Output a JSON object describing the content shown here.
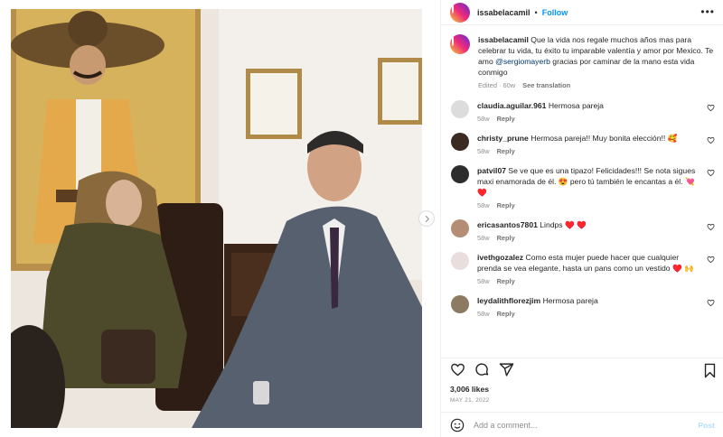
{
  "post": {
    "author": "issabelacamil",
    "follow_label": "Follow",
    "separator": "•",
    "more_label": "•••",
    "caption_text": "Que la vida nos regale muchos años mas para celebrar tu vida, tu éxito tu imparable valentía y amor por Mexico. Te amo",
    "caption_mention": "@sergiomayerb",
    "caption_tail": "gracias por caminar de la mano esta vida conmigo",
    "caption_edited": "Edited · 60w",
    "see_translation": "See translation",
    "likes": "3,006 likes",
    "date": "MAY 21, 2022"
  },
  "comments": [
    {
      "user": "claudia.aguilar.961",
      "text": "Hermosa pareja",
      "age": "58w",
      "reply": "Reply",
      "avatar": "#dcdcdc"
    },
    {
      "user": "christy_prune",
      "text": "Hermosa pareja!! Muy bonita elección!! 🥰",
      "age": "58w",
      "reply": "Reply",
      "avatar": "#3b2a22"
    },
    {
      "user": "patvil07",
      "text": "Se ve que es una tipazo! Felicidades!!! Se nota sigues maxi enamorada de él. 😍 pero tú también le encantas a él. 💘 ♥️",
      "age": "58w",
      "reply": "Reply",
      "avatar": "#2d2d2d"
    },
    {
      "user": "ericasantos7801",
      "text": "Lindps ♥️ ♥️",
      "age": "58w",
      "reply": "Reply",
      "avatar": "#b58d74"
    },
    {
      "user": "ivethgozalez",
      "text": "Como esta mujer puede hacer que cualquier prenda se vea elegante, hasta un pans como un vestido ♥️ 🙌",
      "age": "58w",
      "reply": "Reply",
      "avatar": "#e9dede"
    },
    {
      "user": "leydalithflorezjim",
      "text": "Hermosa pareja",
      "age": "58w",
      "reply": "Reply",
      "avatar": "#8d7a63"
    }
  ],
  "composer": {
    "placeholder": "Add a comment...",
    "post_label": "Post"
  },
  "colors": {
    "accent": "#0095f6",
    "mention": "#00376b",
    "muted": "#8e8e8e"
  }
}
